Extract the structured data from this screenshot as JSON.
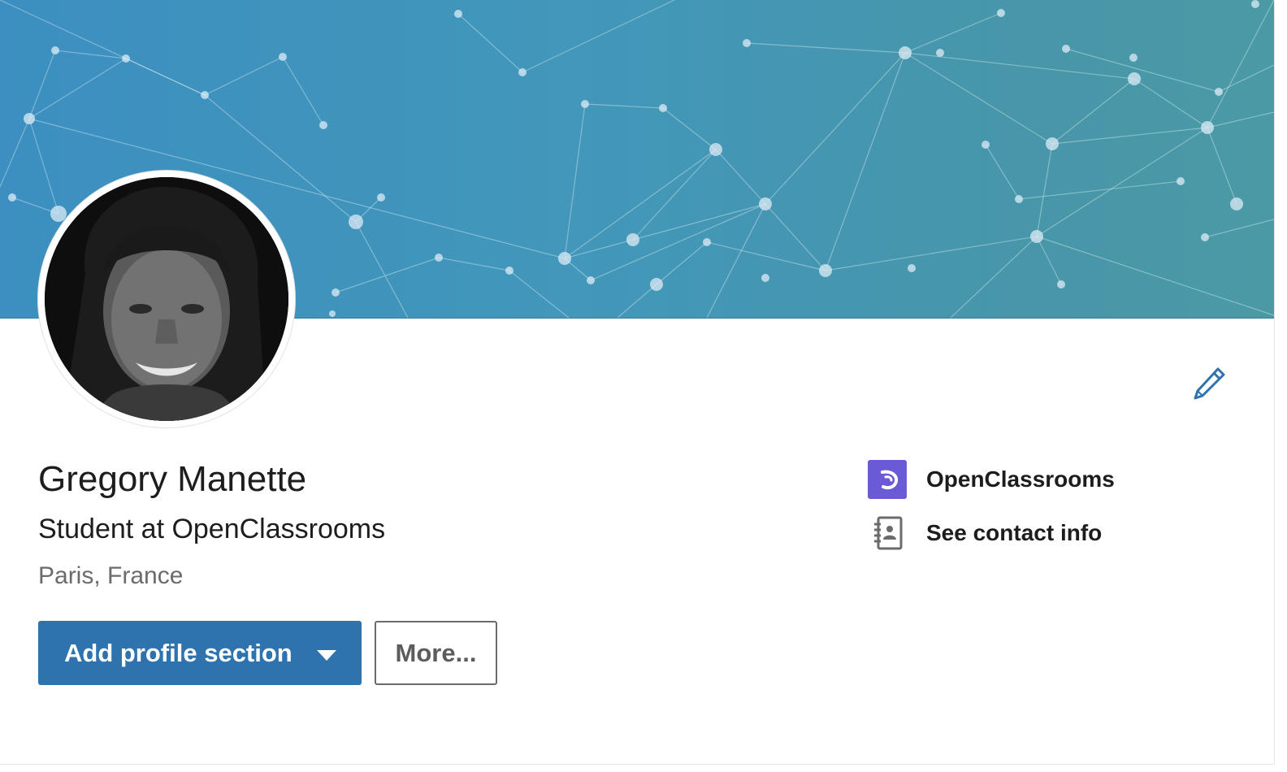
{
  "profile": {
    "name": "Gregory Manette",
    "headline": "Student at OpenClassrooms",
    "location": "Paris, France",
    "avatar": "profile-photo"
  },
  "actions": {
    "primary_label": "Add profile section",
    "secondary_label": "More..."
  },
  "sidebar": {
    "items": [
      {
        "label": "OpenClassrooms",
        "icon": "openclassrooms-logo-icon"
      },
      {
        "label": "See contact info",
        "icon": "contact-book-icon"
      }
    ]
  },
  "icons": {
    "edit": "pencil-icon",
    "dropdown": "caret-down-icon"
  },
  "colors": {
    "banner_start": "#3c8fc0",
    "banner_end": "#4a9aa6",
    "primary_button": "#2e73ad",
    "openclassrooms_brand": "#6b5ad6",
    "edit_icon": "#2e73ad"
  }
}
